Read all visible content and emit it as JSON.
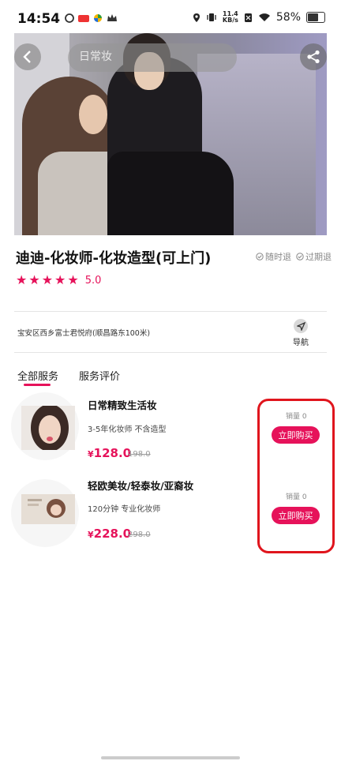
{
  "status_bar": {
    "time": "14:54",
    "speed_top": "11.4",
    "speed_unit": "KB/s",
    "battery": "58%",
    "battery_level": 0.58
  },
  "header": {
    "search_placeholder": "日常妆"
  },
  "shop": {
    "title": "迪迪-化妆师-化妆造型(可上门)",
    "guarantees": [
      "随时退",
      "过期退"
    ],
    "rating_stars": 5,
    "rating": "5.0",
    "address": "宝安区西乡富士君悦府(顺昌路东100米)",
    "nav_label": "导航"
  },
  "tabs": [
    {
      "label": "全部服务",
      "active": true
    },
    {
      "label": "服务评价",
      "active": false
    }
  ],
  "products": [
    {
      "name": "日常精致生活妆",
      "desc": "3-5年化妆师 不含造型",
      "currency": "¥",
      "price": "128.0",
      "old_price": "198.0",
      "sales": "销量 0",
      "buy_label": "立即购买"
    },
    {
      "name": "轻欧美妆/轻泰妆/亚裔妆",
      "desc": "120分钟  专业化妆师",
      "currency": "¥",
      "price": "228.0",
      "old_price": "298.0",
      "sales": "销量 0",
      "buy_label": "立即购买"
    }
  ],
  "colors": {
    "accent": "#e6125a",
    "highlight": "#e0151d"
  }
}
